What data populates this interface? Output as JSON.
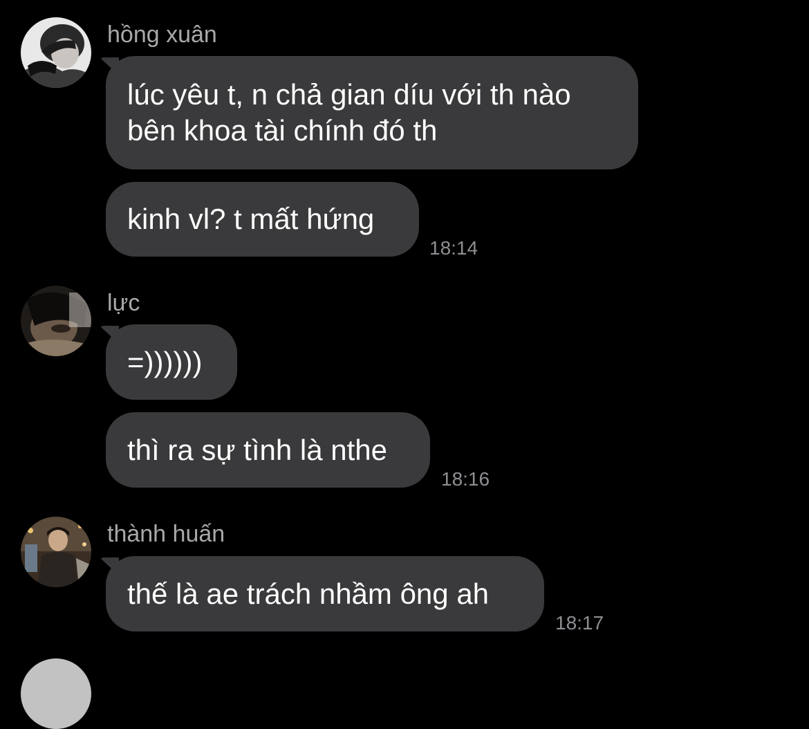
{
  "colors": {
    "background": "#000000",
    "bubble": "#3a3a3c",
    "bubble_text": "#ffffff",
    "sender_name": "#a9a9a9",
    "timestamp": "#8e8e93"
  },
  "messages": [
    {
      "sender": "hồng xuân",
      "avatar_icon": "user-avatar-photo-icon",
      "bubbles": [
        {
          "lines": [
            "lúc yêu t, n chả gian díu với th nào",
            "bên khoa tài chính đó th"
          ]
        },
        {
          "lines": [
            "kinh vl? t mất hứng"
          ]
        }
      ],
      "time": "18:14"
    },
    {
      "sender": "lực",
      "avatar_icon": "user-avatar-photo-icon",
      "bubbles": [
        {
          "lines": [
            "=))))))"
          ]
        },
        {
          "lines": [
            "thì ra sự tình là nthe"
          ]
        }
      ],
      "time": "18:16"
    },
    {
      "sender": "thành huấn",
      "avatar_icon": "user-avatar-photo-icon",
      "bubbles": [
        {
          "lines": [
            "thế là ae trách nhầm ông ah"
          ]
        }
      ],
      "time": "18:17"
    }
  ]
}
